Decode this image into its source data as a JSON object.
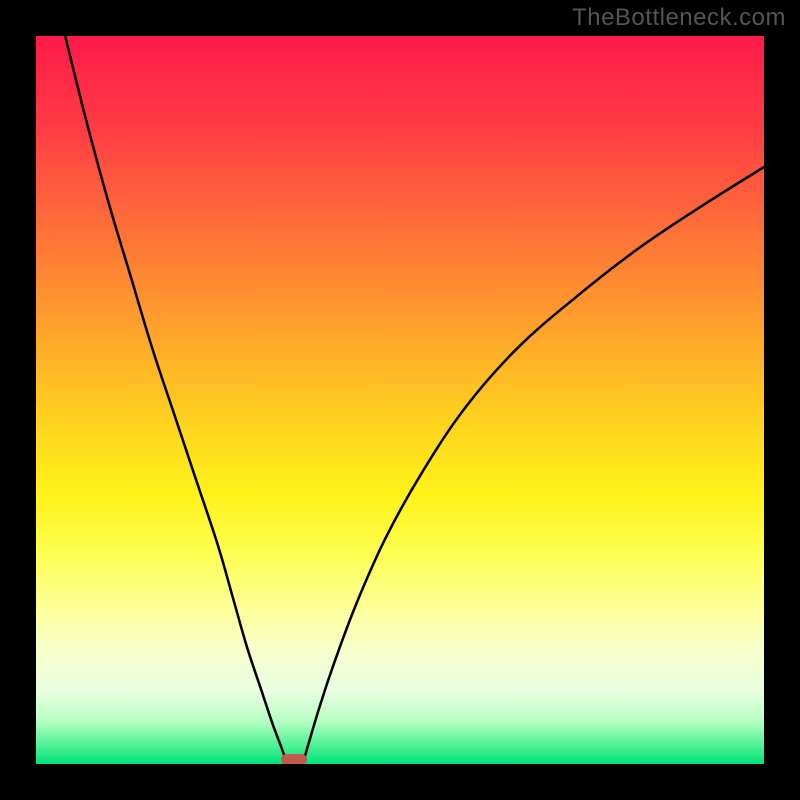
{
  "watermark": "TheBottleneck.com",
  "chart_data": {
    "type": "line",
    "title": "",
    "xlabel": "",
    "ylabel": "",
    "xlim": [
      0,
      100
    ],
    "ylim": [
      0,
      100
    ],
    "grid": false,
    "legend": false,
    "series": [
      {
        "name": "left-curve",
        "x": [
          4,
          7,
          10,
          13,
          16,
          19,
          22,
          25,
          27,
          29,
          31,
          32.5,
          33.7,
          34.3
        ],
        "values": [
          100,
          88,
          77,
          67,
          57,
          48,
          39,
          30,
          23,
          16,
          10,
          5.5,
          2.3,
          0.6
        ]
      },
      {
        "name": "right-curve",
        "x": [
          36.8,
          37.5,
          39,
          41,
          44,
          48,
          53,
          59,
          66,
          74,
          83,
          92,
          100
        ],
        "values": [
          0.6,
          3,
          8,
          14,
          22,
          31,
          40,
          49,
          57,
          64,
          71,
          77,
          82
        ]
      }
    ],
    "annotations": [
      {
        "name": "bottleneck-marker",
        "x": 35.5,
        "y": 0.5,
        "color": "#c0594e"
      }
    ],
    "gradient_stops": [
      {
        "pos": 0.0,
        "color": "#ff1a4b"
      },
      {
        "pos": 0.12,
        "color": "#ff3a44"
      },
      {
        "pos": 0.25,
        "color": "#ff6a3a"
      },
      {
        "pos": 0.38,
        "color": "#ff9a2d"
      },
      {
        "pos": 0.52,
        "color": "#ffcf1f"
      },
      {
        "pos": 0.63,
        "color": "#fff21a"
      },
      {
        "pos": 0.71,
        "color": "#fdff50"
      },
      {
        "pos": 0.79,
        "color": "#fdff9c"
      },
      {
        "pos": 0.85,
        "color": "#f6ffcf"
      },
      {
        "pos": 0.9,
        "color": "#e8ffe0"
      },
      {
        "pos": 0.94,
        "color": "#b8ffc4"
      },
      {
        "pos": 0.97,
        "color": "#5cf49a"
      },
      {
        "pos": 1.0,
        "color": "#00e27b"
      }
    ]
  }
}
